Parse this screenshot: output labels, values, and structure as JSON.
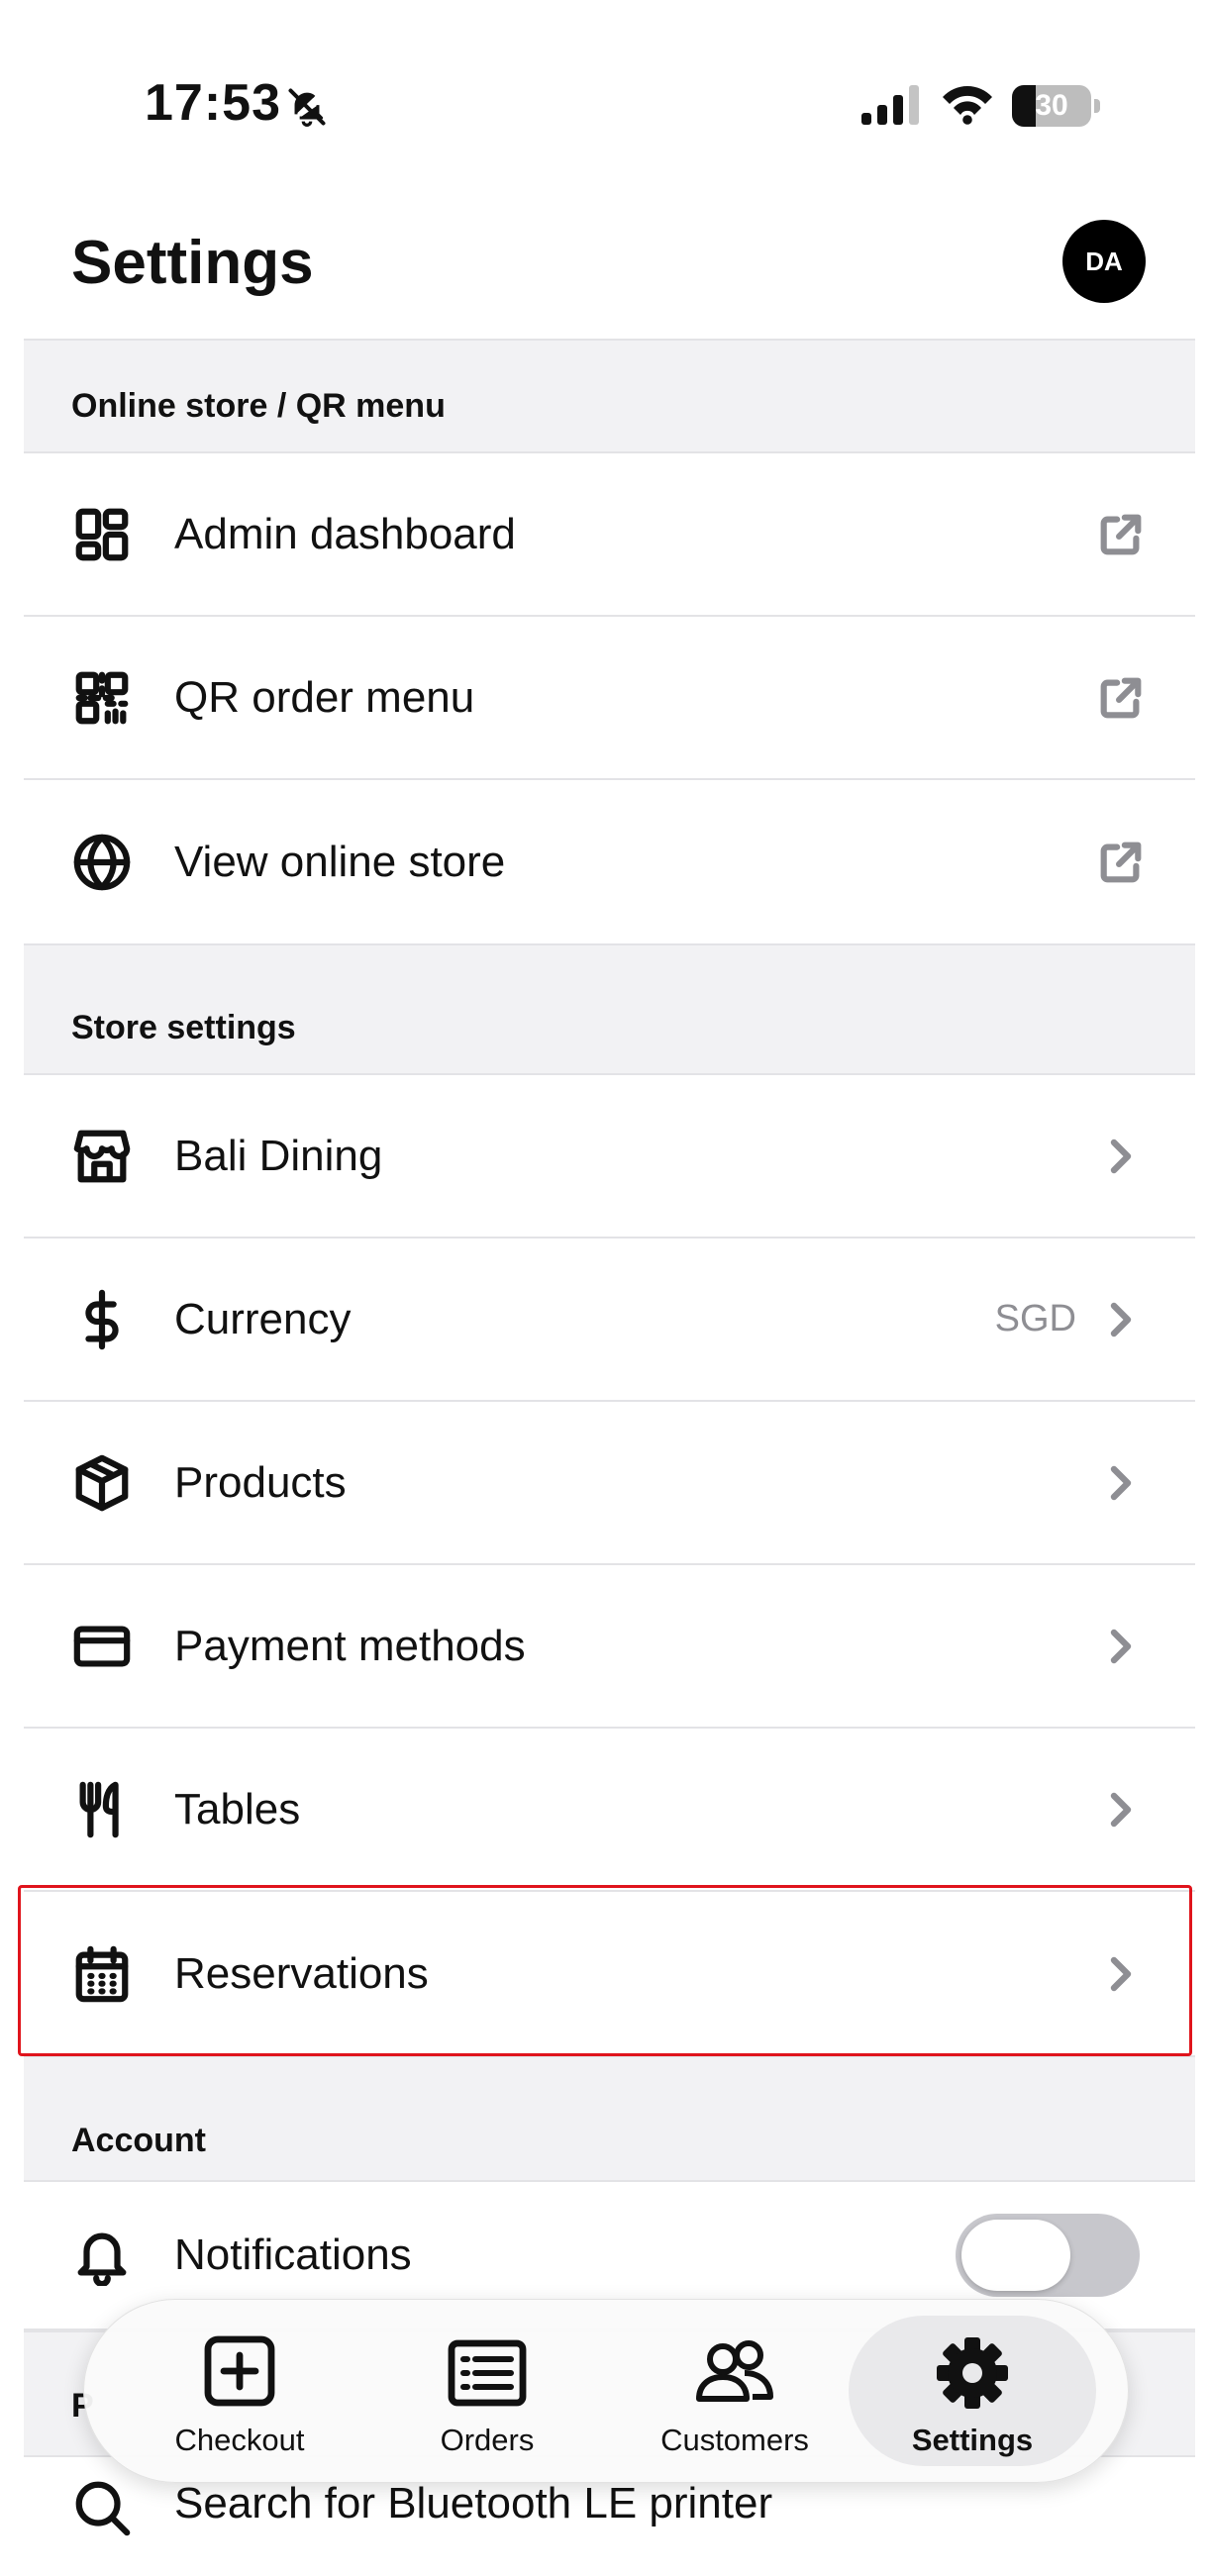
{
  "status_bar": {
    "time": "17:53",
    "battery_percent": "30",
    "battery_level": 0.3
  },
  "header": {
    "title": "Settings",
    "avatar_initials": "DA"
  },
  "sections": {
    "online_store": {
      "title": "Online store / QR menu",
      "items": [
        {
          "label": "Admin dashboard",
          "icon": "dashboard-icon",
          "action": "external-link-icon"
        },
        {
          "label": "QR order menu",
          "icon": "qr-code-icon",
          "action": "external-link-icon"
        },
        {
          "label": "View online store",
          "icon": "globe-icon",
          "action": "external-link-icon"
        }
      ]
    },
    "store_settings": {
      "title": "Store settings",
      "items": [
        {
          "label": "Bali Dining",
          "icon": "store-icon",
          "action": "chevron-right-icon"
        },
        {
          "label": "Currency",
          "icon": "dollar-icon",
          "value": "SGD",
          "action": "chevron-right-icon"
        },
        {
          "label": "Products",
          "icon": "box-icon",
          "action": "chevron-right-icon"
        },
        {
          "label": "Payment methods",
          "icon": "credit-card-icon",
          "action": "chevron-right-icon"
        },
        {
          "label": "Tables",
          "icon": "utensils-icon",
          "action": "chevron-right-icon"
        },
        {
          "label": "Reservations",
          "icon": "calendar-icon",
          "action": "chevron-right-icon"
        }
      ]
    },
    "account": {
      "title": "Account",
      "items": [
        {
          "label": "Notifications",
          "icon": "bell-icon",
          "toggle_on": false
        }
      ]
    },
    "printers": {
      "title": "P",
      "items": [
        {
          "label": "Search for Bluetooth LE printer",
          "icon": "search-icon"
        }
      ]
    }
  },
  "tabbar": {
    "items": [
      {
        "label": "Checkout",
        "icon": "plus-square-icon",
        "active": false
      },
      {
        "label": "Orders",
        "icon": "receipt-list-icon",
        "active": false
      },
      {
        "label": "Customers",
        "icon": "users-icon",
        "active": false
      },
      {
        "label": "Settings",
        "icon": "gear-icon",
        "active": true
      }
    ]
  },
  "colors": {
    "highlight_border": "#e0141c",
    "section_background": "#f2f2f4",
    "toggle_off": "#c7c7cc",
    "secondary_text": "#8e8e93"
  }
}
